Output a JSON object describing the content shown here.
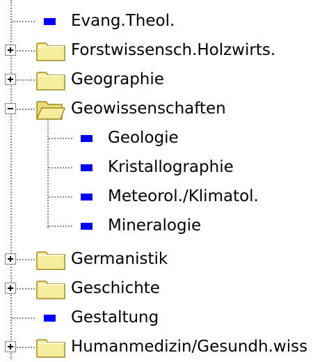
{
  "colors": {
    "leaf_icon": "#0000f5",
    "folder_fill": "#f6ed9c",
    "folder_edge": "#a08a20",
    "tree_lines": "#8a8a8a"
  },
  "tree": {
    "items": [
      {
        "label": "Evang.Theol.",
        "kind": "leaf",
        "level": 0
      },
      {
        "label": "Forstwissensch.Holzwirts.",
        "kind": "folder",
        "state": "collapsed",
        "level": 0
      },
      {
        "label": "Geographie",
        "kind": "folder",
        "state": "collapsed",
        "level": 0
      },
      {
        "label": "Geowissenschaften",
        "kind": "folder",
        "state": "expanded",
        "level": 0
      },
      {
        "label": "Geologie",
        "kind": "leaf",
        "level": 1
      },
      {
        "label": "Kristallographie",
        "kind": "leaf",
        "level": 1
      },
      {
        "label": "Meteorol./Klimatol.",
        "kind": "leaf",
        "level": 1
      },
      {
        "label": "Mineralogie",
        "kind": "leaf",
        "level": 1
      },
      {
        "label": "Germanistik",
        "kind": "folder",
        "state": "collapsed",
        "level": 0
      },
      {
        "label": "Geschichte",
        "kind": "folder",
        "state": "collapsed",
        "level": 0
      },
      {
        "label": "Gestaltung",
        "kind": "leaf",
        "level": 0
      },
      {
        "label": "Humanmedizin/Gesundh.wiss",
        "kind": "folder",
        "state": "collapsed",
        "level": 0
      }
    ]
  }
}
